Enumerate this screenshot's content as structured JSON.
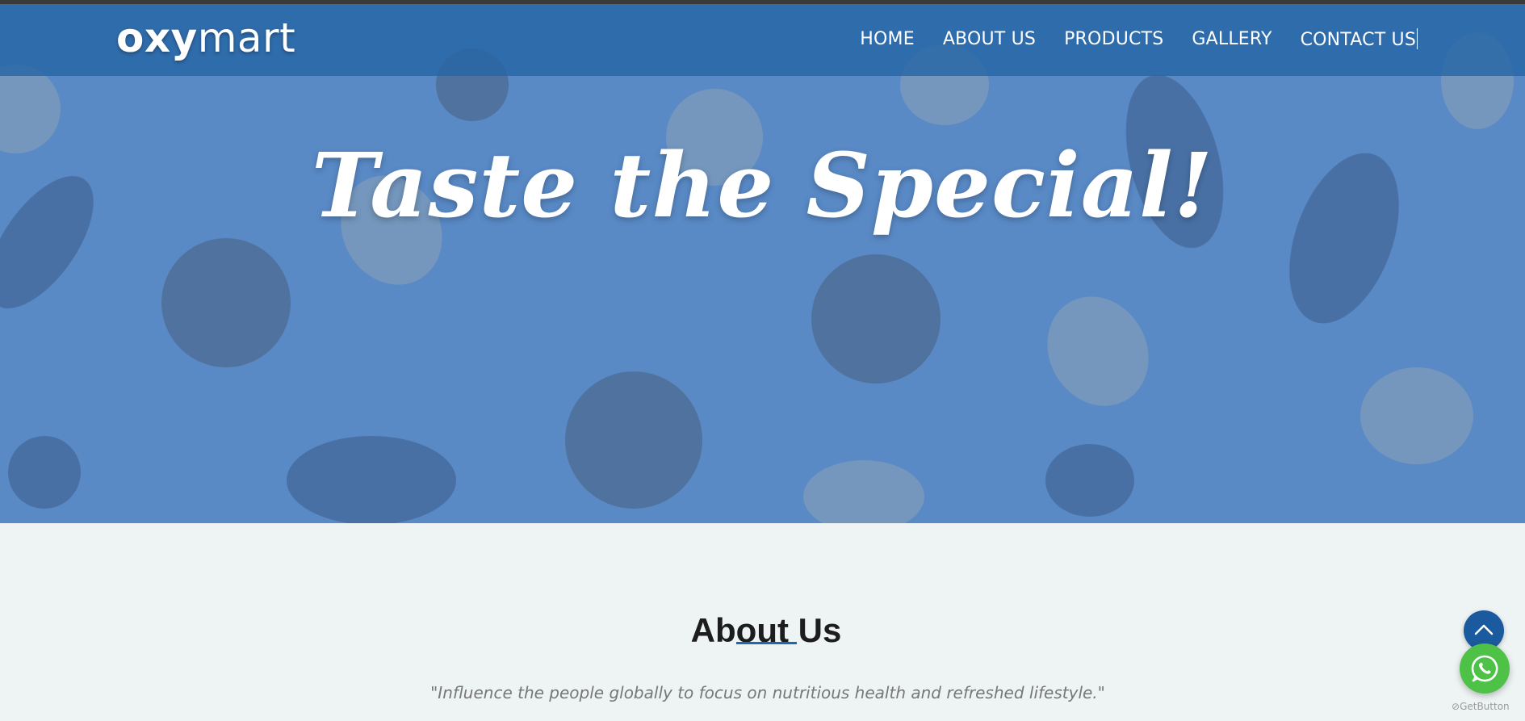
{
  "brand": {
    "logo_bold": "oxy",
    "logo_light": "mart"
  },
  "nav": {
    "items": [
      {
        "label": "HOME"
      },
      {
        "label": "ABOUT US"
      },
      {
        "label": "PRODUCTS"
      },
      {
        "label": "GALLERY"
      },
      {
        "label": "CONTACT US"
      }
    ]
  },
  "hero": {
    "headline": "Taste the Special!"
  },
  "about": {
    "title": "About Us",
    "quote": "\"Influence the people globally to focus on nutritious health and refreshed lifestyle.\""
  },
  "widgets": {
    "back_to_top_icon": "chevron-up-icon",
    "whatsapp_icon": "whatsapp-icon",
    "getbutton_label": "GetButton"
  },
  "colors": {
    "navbar": "#2767a6",
    "hero_tint": "#5a8ac6",
    "accent": "#1f66b3",
    "whatsapp": "#4dc247",
    "back_to_top": "#1b5a9e",
    "page_bg": "#eef3f3"
  }
}
